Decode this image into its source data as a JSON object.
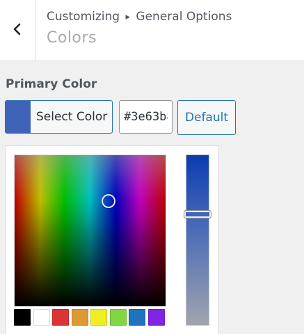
{
  "header": {
    "back_icon": "chevron-left-icon",
    "breadcrumb_parent": "Customizing",
    "breadcrumb_separator": "▸",
    "breadcrumb_child": "General Options",
    "panel_title": "Colors"
  },
  "control": {
    "label": "Primary Color",
    "current_color": "#3e63b8",
    "select_button_label": "Select Color",
    "hex_value": "#3e63b8",
    "default_button_label": "Default"
  },
  "picker": {
    "strip_top_color": "#0b3bb0",
    "strip_bottom_color": "#a0a4ae",
    "strip_value": 0.35,
    "palette": [
      {
        "name": "black",
        "color": "#000000"
      },
      {
        "name": "white",
        "color": "#ffffff"
      },
      {
        "name": "red",
        "color": "#dd3333"
      },
      {
        "name": "orange",
        "color": "#dd9933"
      },
      {
        "name": "yellow",
        "color": "#eeee22"
      },
      {
        "name": "green",
        "color": "#81d742"
      },
      {
        "name": "blue",
        "color": "#1e73be"
      },
      {
        "name": "purple",
        "color": "#8224e3"
      }
    ]
  }
}
